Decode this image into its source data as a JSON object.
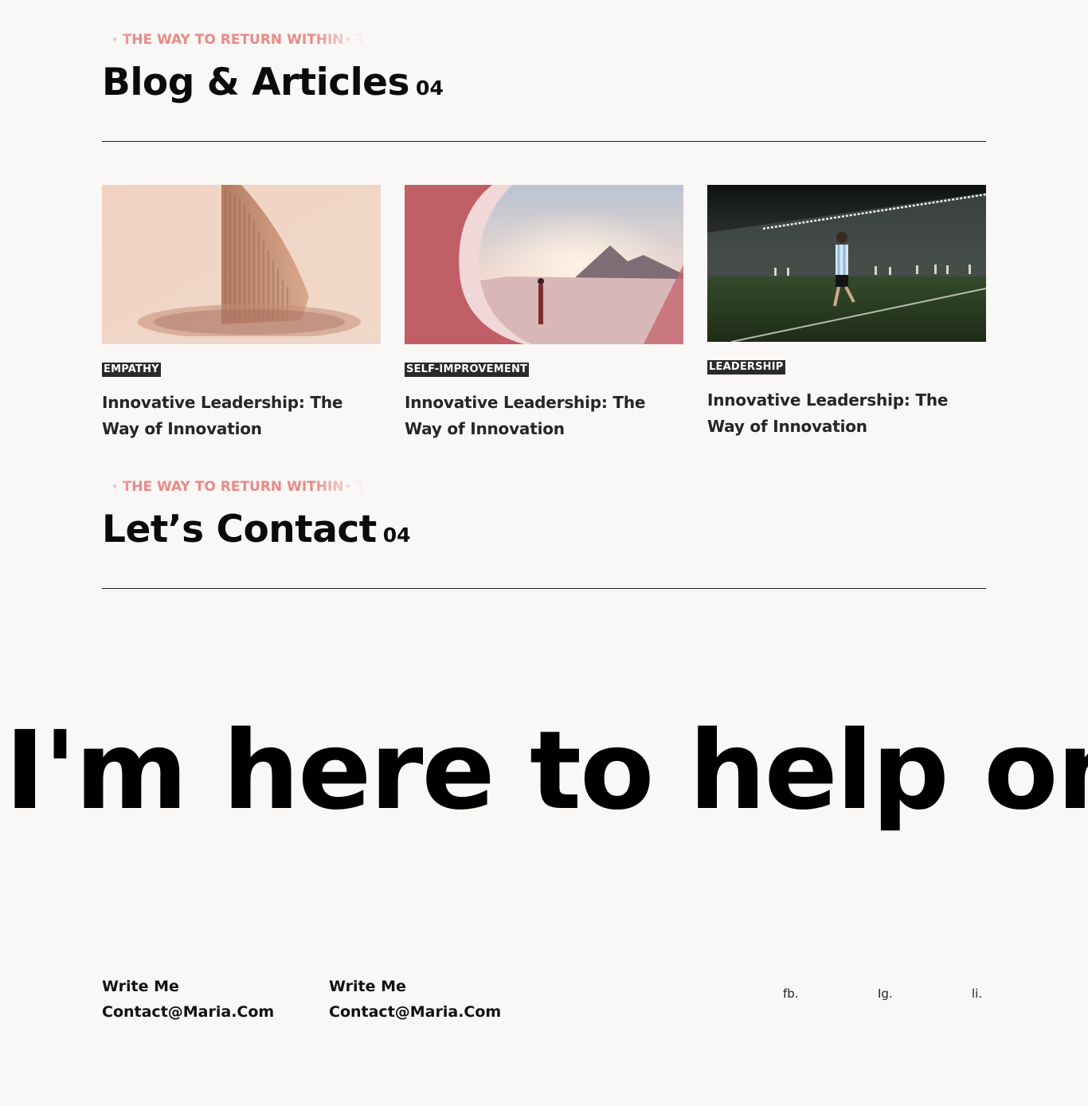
{
  "blog": {
    "ticker_dot": "•",
    "ticker_text": "THE WAY TO RETURN WITHIN",
    "ticker_tail": "THE WAY TO RETURN WITHIN",
    "title": "Blog & Articles",
    "count": "04",
    "posts": [
      {
        "tag": "EMPATHY",
        "title": "Innovative Leadership: The Way of Innovation"
      },
      {
        "tag": "SELF-IMPROVEMENT",
        "title": "Innovative Leadership: The Way of Innovation"
      },
      {
        "tag": "LEADERSHIP",
        "title": "Innovative Leadership: The Way of Innovation"
      }
    ]
  },
  "contact_section": {
    "ticker_dot": "•",
    "ticker_text": "THE WAY TO RETURN WITHIN",
    "ticker_tail": "THE WAY TO RETURN WITHIN",
    "title": "Let’s Contact",
    "count": "04"
  },
  "marquee": "I'm here to help on y",
  "contacts": [
    {
      "label": "Write Me",
      "value": "Contact@Maria.Com"
    },
    {
      "label": "Write Me",
      "value": "Contact@Maria.Com"
    }
  ],
  "social": {
    "fb": "fb.",
    "ig": "Ig.",
    "li": "li."
  },
  "colors": {
    "accent": "#ea8a86",
    "tag_bg": "#2a2a2a",
    "background": "#f9f8f6"
  }
}
